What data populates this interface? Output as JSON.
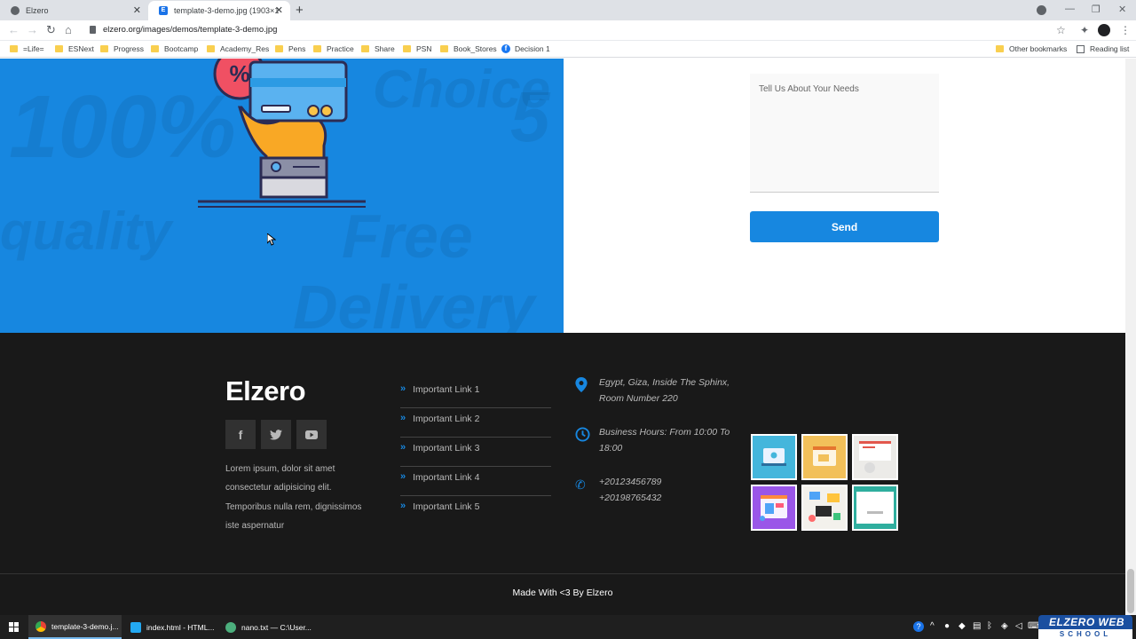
{
  "browser": {
    "tabs": [
      {
        "title": "Elzero",
        "active": false
      },
      {
        "title": "template-3-demo.jpg (1903×14…",
        "active": true
      }
    ],
    "active_tab_fav": "E",
    "url": "elzero.org/images/demos/template-3-demo.jpg",
    "bookmarks": [
      "=Life=",
      "ESNext",
      "Progress",
      "Bootcamp",
      "Academy_Res",
      "Pens",
      "Practice",
      "Share",
      "PSN",
      "Book_Stores",
      "Decision 1"
    ],
    "other_bookmarks": "Other bookmarks",
    "reading_list": "Reading list"
  },
  "hero_background_words": [
    "100%",
    "quality",
    "Free",
    "Delivery",
    "Choice",
    "5"
  ],
  "form": {
    "needs_placeholder": "Tell Us About Your Needs",
    "send_label": "Send"
  },
  "footer": {
    "logo": "Elzero",
    "social": [
      "facebook-icon",
      "twitter-icon",
      "youtube-icon"
    ],
    "description": "Lorem ipsum, dolor sit amet consectetur adipisicing elit. Temporibus nulla rem, dignissimos iste aspernatur",
    "links": [
      "Important Link 1",
      "Important Link 2",
      "Important Link 3",
      "Important Link 4",
      "Important Link 5"
    ],
    "contact": {
      "address": "Egypt, Giza, Inside The Sphinx, Room Number 220",
      "hours": "Business Hours: From 10:00 To 18:00",
      "phone1": "+20123456789",
      "phone2": "+20198765432"
    },
    "gallery": [
      {
        "name": "gallery-image-1",
        "color": "#44b6dc"
      },
      {
        "name": "gallery-image-2",
        "color": "#f2c05a"
      },
      {
        "name": "gallery-image-3",
        "color": "#ecebe8"
      },
      {
        "name": "gallery-image-4",
        "color": "#9a56e8"
      },
      {
        "name": "gallery-image-5",
        "color": "#f3f1ec"
      },
      {
        "name": "gallery-image-6",
        "color": "#2fae9e"
      }
    ],
    "gallery_label": "WEB DESIGN",
    "copyright": "Made With <3 By Elzero"
  },
  "taskbar": {
    "items": [
      "template-3-demo.j...",
      "index.html - HTML...",
      "nano.txt — C:\\User..."
    ],
    "brand_line1": "ELZERO WEB",
    "brand_line2": "SCHOOL"
  },
  "colors": {
    "accent": "#1787e0",
    "footer_bg": "#191919"
  }
}
